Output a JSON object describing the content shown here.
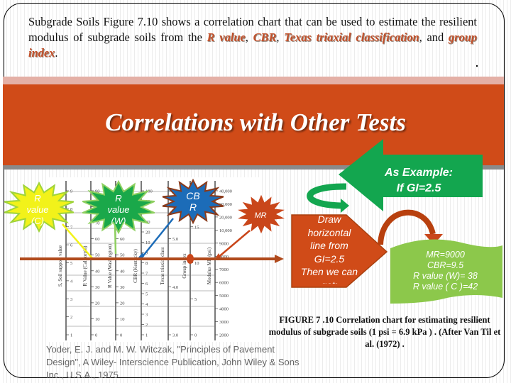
{
  "intro": {
    "text_parts": [
      "Subgrade Soils Figure 7.10 shows a correlation chart that can be used to estimate the resilient modulus of subgrade soils from the ",
      ", ",
      ", ",
      ", and ",
      "."
    ],
    "keywords": [
      "R value",
      "CBR",
      "Texas triaxial classification",
      "group index"
    ],
    "trailing_mark": "."
  },
  "banner": {
    "title": "Correlations with Other Tests"
  },
  "callouts": {
    "example": {
      "line1": "As Example:",
      "line2": "If GI=2.5"
    },
    "draw": {
      "lines": [
        "Draw",
        "horizontal",
        "line from",
        "GI=2.5",
        "Then we can",
        "get:"
      ]
    },
    "result": {
      "lines": [
        "MR=9000",
        "CBR=9.5",
        "R value (W)= 38",
        "R value  ( C )=42"
      ]
    }
  },
  "stars": [
    {
      "id": "r-value-c",
      "lines": [
        "R",
        "value",
        "(C)"
      ],
      "fill": "#f2f21a",
      "stroke": "#9fd33a",
      "text_color": "#ffffff"
    },
    {
      "id": "r-value-w",
      "lines": [
        "R",
        "value",
        "(W)"
      ],
      "fill": "#1aa84a",
      "stroke": "#8fd060",
      "text_color": "#ffffff"
    },
    {
      "id": "cbr",
      "lines": [
        "CB",
        "R"
      ],
      "fill": "#1c6cb8",
      "stroke": "#8a3a1a",
      "text_color": "#ffffff"
    },
    {
      "id": "mr",
      "lines": [
        "MR"
      ],
      "fill": "#c9461a",
      "stroke": "#c9461a",
      "text_color": "#ffffff"
    }
  ],
  "colors": {
    "banner": "#d04b18",
    "arrow_green": "#13a64f",
    "result_green": "#8cc84b",
    "draw_orange": "#d04b18",
    "line_brown": "#b04a1c",
    "keyword": "#c2502a"
  },
  "chart_data": {
    "type": "nomograph",
    "title": "Correlation chart for estimating resilient modulus of subgrade soils",
    "scales": [
      {
        "label": "S, Soil support value",
        "ticks": [
          "1",
          "2",
          "3",
          "4",
          "5",
          "6",
          "7",
          "8",
          "9"
        ]
      },
      {
        "label": "R Value (California)",
        "ticks": [
          "0",
          "10",
          "20",
          "30",
          "40",
          "50",
          "60",
          "70",
          "80",
          "90"
        ]
      },
      {
        "label": "R Value (Washington)",
        "ticks": [
          "0",
          "10",
          "20",
          "30",
          "40",
          "50",
          "60",
          "70",
          "80",
          "90"
        ]
      },
      {
        "label": "CBR (Kentucky)",
        "ticks": [
          "1",
          "2",
          "3",
          "4",
          "5",
          "6",
          "7",
          "8",
          "9",
          "10",
          "20",
          "30",
          "40",
          "50",
          "100"
        ]
      },
      {
        "label": "Texas triaxial class",
        "ticks": [
          "3.0",
          "4.0",
          "5.0",
          "6.0"
        ]
      },
      {
        "label": "Group index",
        "ticks": [
          "0",
          "5",
          "10",
          "15",
          "20"
        ]
      },
      {
        "label": "Modulus MR (psi)",
        "ticks": [
          "2000",
          "3000",
          "4000",
          "5000",
          "6000",
          "7000",
          "8000",
          "9000",
          "10,000",
          "20,000",
          "30,000",
          "40,000"
        ]
      }
    ],
    "example": {
      "group_index": 2.5,
      "MR_psi": 9000,
      "CBR": 9.5,
      "R_value_W": 38,
      "R_value_C": 42
    }
  },
  "figure_caption": "FIGURE 7 .10 Correlation chart for estimating resilient modulus of subgrade soils (1 psi = 6.9 kPa ) . (After Van Til et al. (1972) .",
  "reference": "Yoder, E. J. and M. W. Witczak, \"Principles of Pavement Design\", A Wiley- Interscience Publication, John Wiley & Sons Inc., U.S.A., 1975"
}
